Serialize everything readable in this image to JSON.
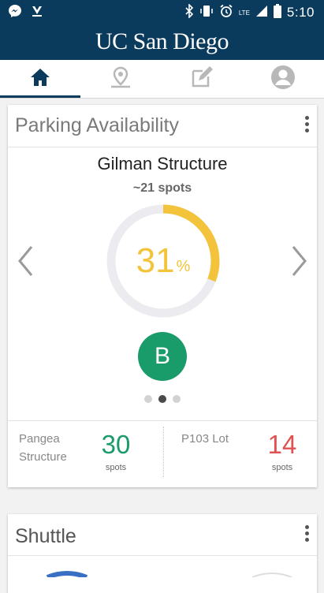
{
  "status_bar": {
    "time": "5:10",
    "network_label": "LTE",
    "icons": [
      "messenger-icon",
      "download-icon",
      "bluetooth-icon",
      "vibrate-icon",
      "alarm-icon",
      "signal-icon",
      "battery-icon"
    ]
  },
  "header": {
    "title": "UC San Diego"
  },
  "tabs": [
    {
      "name": "home",
      "icon": "home-icon",
      "active": true
    },
    {
      "name": "map",
      "icon": "map-pin-icon",
      "active": false
    },
    {
      "name": "edit",
      "icon": "edit-icon",
      "active": false
    },
    {
      "name": "profile",
      "icon": "profile-icon",
      "active": false
    }
  ],
  "parking_card": {
    "title": "Parking Availability",
    "structure_name": "Gilman Structure",
    "spots_approx": "~21 spots",
    "percent_value": "31",
    "percent_unit": "%",
    "occupancy_fraction": 0.31,
    "permit_badge": "B",
    "pager": {
      "count": 3,
      "active_index": 1
    },
    "lots": [
      {
        "name": "Pangea Structure",
        "count": "30",
        "unit": "spots",
        "color": "#1a9b6a"
      },
      {
        "name": "P103 Lot",
        "count": "14",
        "unit": "spots",
        "color": "#e05252"
      }
    ]
  },
  "shuttle_card": {
    "title": "Shuttle"
  },
  "colors": {
    "brand_navy": "#0b3b5c",
    "gauge_yellow": "#f3c43b",
    "badge_green": "#1a9b6a",
    "low_red": "#e05252"
  }
}
